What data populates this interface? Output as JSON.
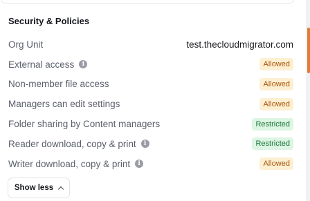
{
  "section": {
    "title": "Security & Policies"
  },
  "rows": [
    {
      "label": "Org Unit",
      "info": false,
      "value": "test.thecloudmigrator.com",
      "kind": "text"
    },
    {
      "label": "External access",
      "info": true,
      "value": "Allowed",
      "kind": "allowed"
    },
    {
      "label": "Non-member file access",
      "info": false,
      "value": "Allowed",
      "kind": "allowed"
    },
    {
      "label": "Managers can edit settings",
      "info": false,
      "value": "Allowed",
      "kind": "allowed"
    },
    {
      "label": "Folder sharing by Content managers",
      "info": false,
      "value": "Restricted",
      "kind": "restricted"
    },
    {
      "label": "Reader download, copy & print",
      "info": true,
      "value": "Restricted",
      "kind": "restricted"
    },
    {
      "label": "Writer download, copy & print",
      "info": true,
      "value": "Allowed",
      "kind": "allowed"
    }
  ],
  "show_less": {
    "label": "Show less",
    "icon": "chevron-up-icon"
  },
  "icons": {
    "info": "info-icon",
    "info_glyph": "i"
  },
  "colors": {
    "allowed_bg": "#fdf0d2",
    "allowed_text": "#a9540c",
    "restricted_bg": "#ddf5e3",
    "restricted_text": "#18743b",
    "scroll_accent": "#e07b3a"
  }
}
